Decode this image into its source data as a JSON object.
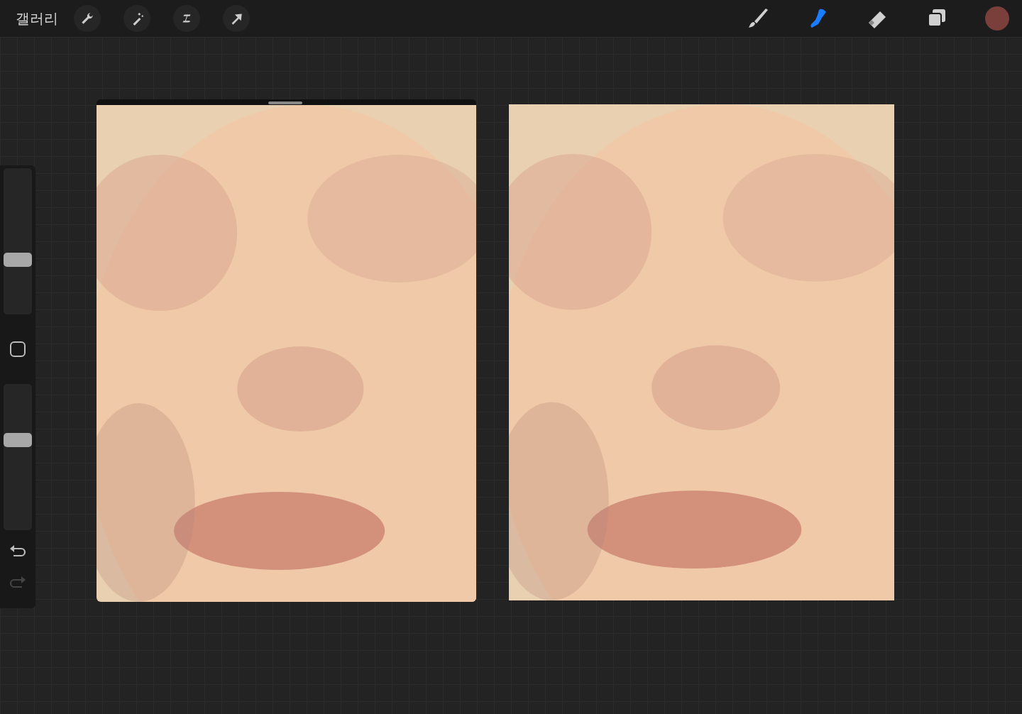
{
  "top_bar": {
    "gallery": "갤러리",
    "actions": [
      {
        "kind": "wrench"
      },
      {
        "kind": "wand"
      },
      {
        "kind": "selection"
      },
      {
        "kind": "transform"
      }
    ],
    "tools": [
      {
        "kind": "brush",
        "selected": false
      },
      {
        "kind": "smudge",
        "selected": true
      },
      {
        "kind": "eraser",
        "selected": false
      },
      {
        "kind": "layers",
        "selected": false
      }
    ],
    "color": "#7a3f3a"
  },
  "sidebar": {
    "size": {
      "level": 0.36
    },
    "opacity": {
      "level": 0.63
    },
    "redo_disabled": true
  }
}
